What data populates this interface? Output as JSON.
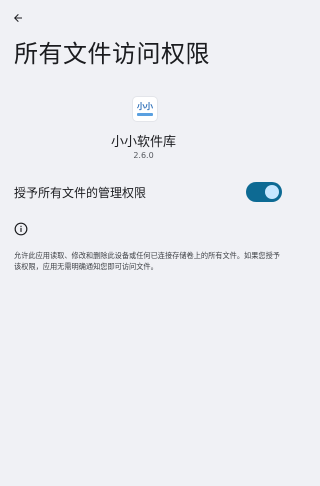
{
  "header": {
    "back_icon": "arrow-left-icon",
    "title": "所有文件访问权限"
  },
  "app": {
    "icon_text": "小小",
    "name": "小小软件库",
    "version": "2.6.0"
  },
  "permission": {
    "label": "授予所有文件的管理权限",
    "enabled": true
  },
  "info": {
    "icon": "info-icon",
    "text": "允许此应用读取、修改和删除此设备或任何已连接存储卷上的所有文件。如果您授予该权限，应用无需明确通知您即可访问文件。"
  },
  "colors": {
    "background": "#f0f1f5",
    "toggle_track": "#0d6a93",
    "toggle_thumb": "#c6e7ff"
  }
}
